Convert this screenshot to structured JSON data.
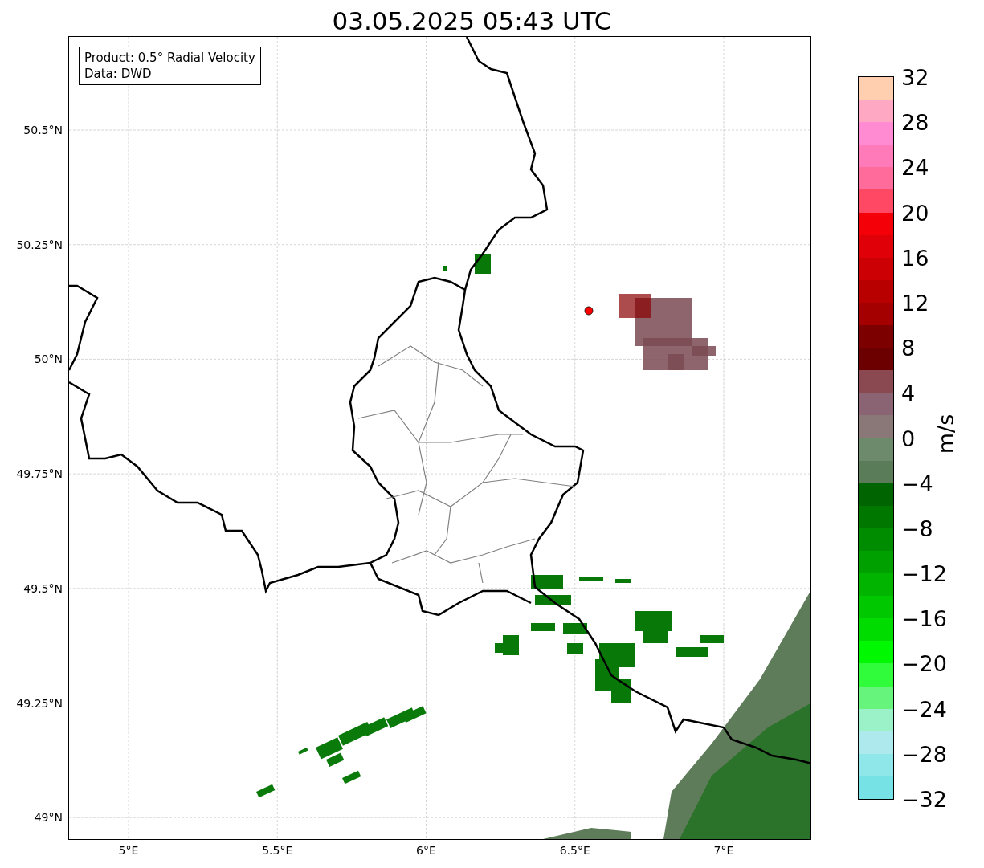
{
  "title": "03.05.2025 05:43 UTC",
  "legend": [
    "Product: 0.5° Radial Velocity",
    "Data: DWD"
  ],
  "y_ticks": [
    "50.5°N",
    "50.25°N",
    "50°N",
    "49.75°N",
    "49.5°N",
    "49.25°N",
    "49°N"
  ],
  "x_ticks": [
    "5°E",
    "5.5°E",
    "6°E",
    "6.5°E",
    "7°E"
  ],
  "colorbar": {
    "unit": "m/s",
    "ticks": [
      "32",
      "28",
      "24",
      "20",
      "16",
      "12",
      "8",
      "4",
      "0",
      "−4",
      "−8",
      "−12",
      "−16",
      "−20",
      "−24",
      "−28",
      "−32"
    ],
    "segments": [
      {
        "color": "#ffcfb0"
      },
      {
        "color": "#ffa8c4"
      },
      {
        "color": "#ff8cd2"
      },
      {
        "color": "#ff7ab8"
      },
      {
        "color": "#ff6c9c"
      },
      {
        "color": "#ff4864"
      },
      {
        "color": "#f40008"
      },
      {
        "color": "#e00008"
      },
      {
        "color": "#cc0004"
      },
      {
        "color": "#b80000"
      },
      {
        "color": "#a40000"
      },
      {
        "color": "#7c0000"
      },
      {
        "color": "#6c0000"
      },
      {
        "color": "#8a4850"
      },
      {
        "color": "#8a6472"
      },
      {
        "color": "#8a7878"
      },
      {
        "color": "#6e8a6c"
      },
      {
        "color": "#5a7c58"
      },
      {
        "color": "#006400"
      },
      {
        "color": "#007800"
      },
      {
        "color": "#008c00"
      },
      {
        "color": "#00a000"
      },
      {
        "color": "#00b400"
      },
      {
        "color": "#00c800"
      },
      {
        "color": "#00dc00"
      },
      {
        "color": "#00f800"
      },
      {
        "color": "#30fc3c"
      },
      {
        "color": "#66f47c"
      },
      {
        "color": "#9cf2c8"
      },
      {
        "color": "#aee9ee"
      },
      {
        "color": "#90e7ea"
      },
      {
        "color": "#76e2e6"
      }
    ]
  }
}
